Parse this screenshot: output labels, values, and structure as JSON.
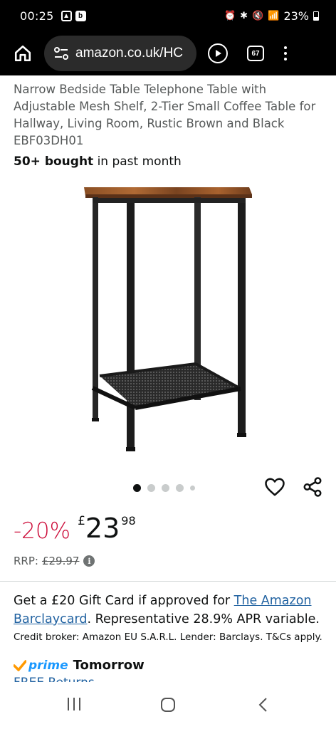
{
  "status_bar": {
    "time": "00:25",
    "battery": "23%"
  },
  "browser": {
    "url": "amazon.co.uk/HC",
    "tab_count": "67"
  },
  "product": {
    "title": "Narrow Bedside Table Telephone Table with Adjustable Mesh Shelf, 2-Tier Small Coffee Table for Hallway, Living Room, Rustic Brown and Black EBF03DH01",
    "bought_bold": "50+ bought",
    "bought_rest": " in past month"
  },
  "carousel": {
    "dot_count": 5,
    "active_index": 0
  },
  "pricing": {
    "discount": "-20%",
    "currency": "£",
    "whole": "23",
    "fraction": "98",
    "rrp_label": "RRP:",
    "rrp_value": "£29.97",
    "info_icon": "i"
  },
  "gift_card": {
    "text_before": "Get a £20 Gift Card if approved for ",
    "link": "The Amazon Barclaycard",
    "text_after": ". Representative 28.9% APR variable.",
    "credit": "Credit broker: Amazon EU S.A.R.L. Lender: Barclays. T&Cs apply."
  },
  "delivery": {
    "prime": "prime",
    "when": "Tomorrow",
    "returns": "FREE Returns"
  },
  "colors": {
    "discount": "#cc0c39",
    "link": "#2162a1",
    "prime_blue": "#1a98ff",
    "prime_check": "#ff9900"
  },
  "icons": [
    "home-icon",
    "tune-icon",
    "play-icon",
    "tabs-icon",
    "menu-icon",
    "heart-icon",
    "share-icon",
    "info-icon",
    "check-icon"
  ]
}
